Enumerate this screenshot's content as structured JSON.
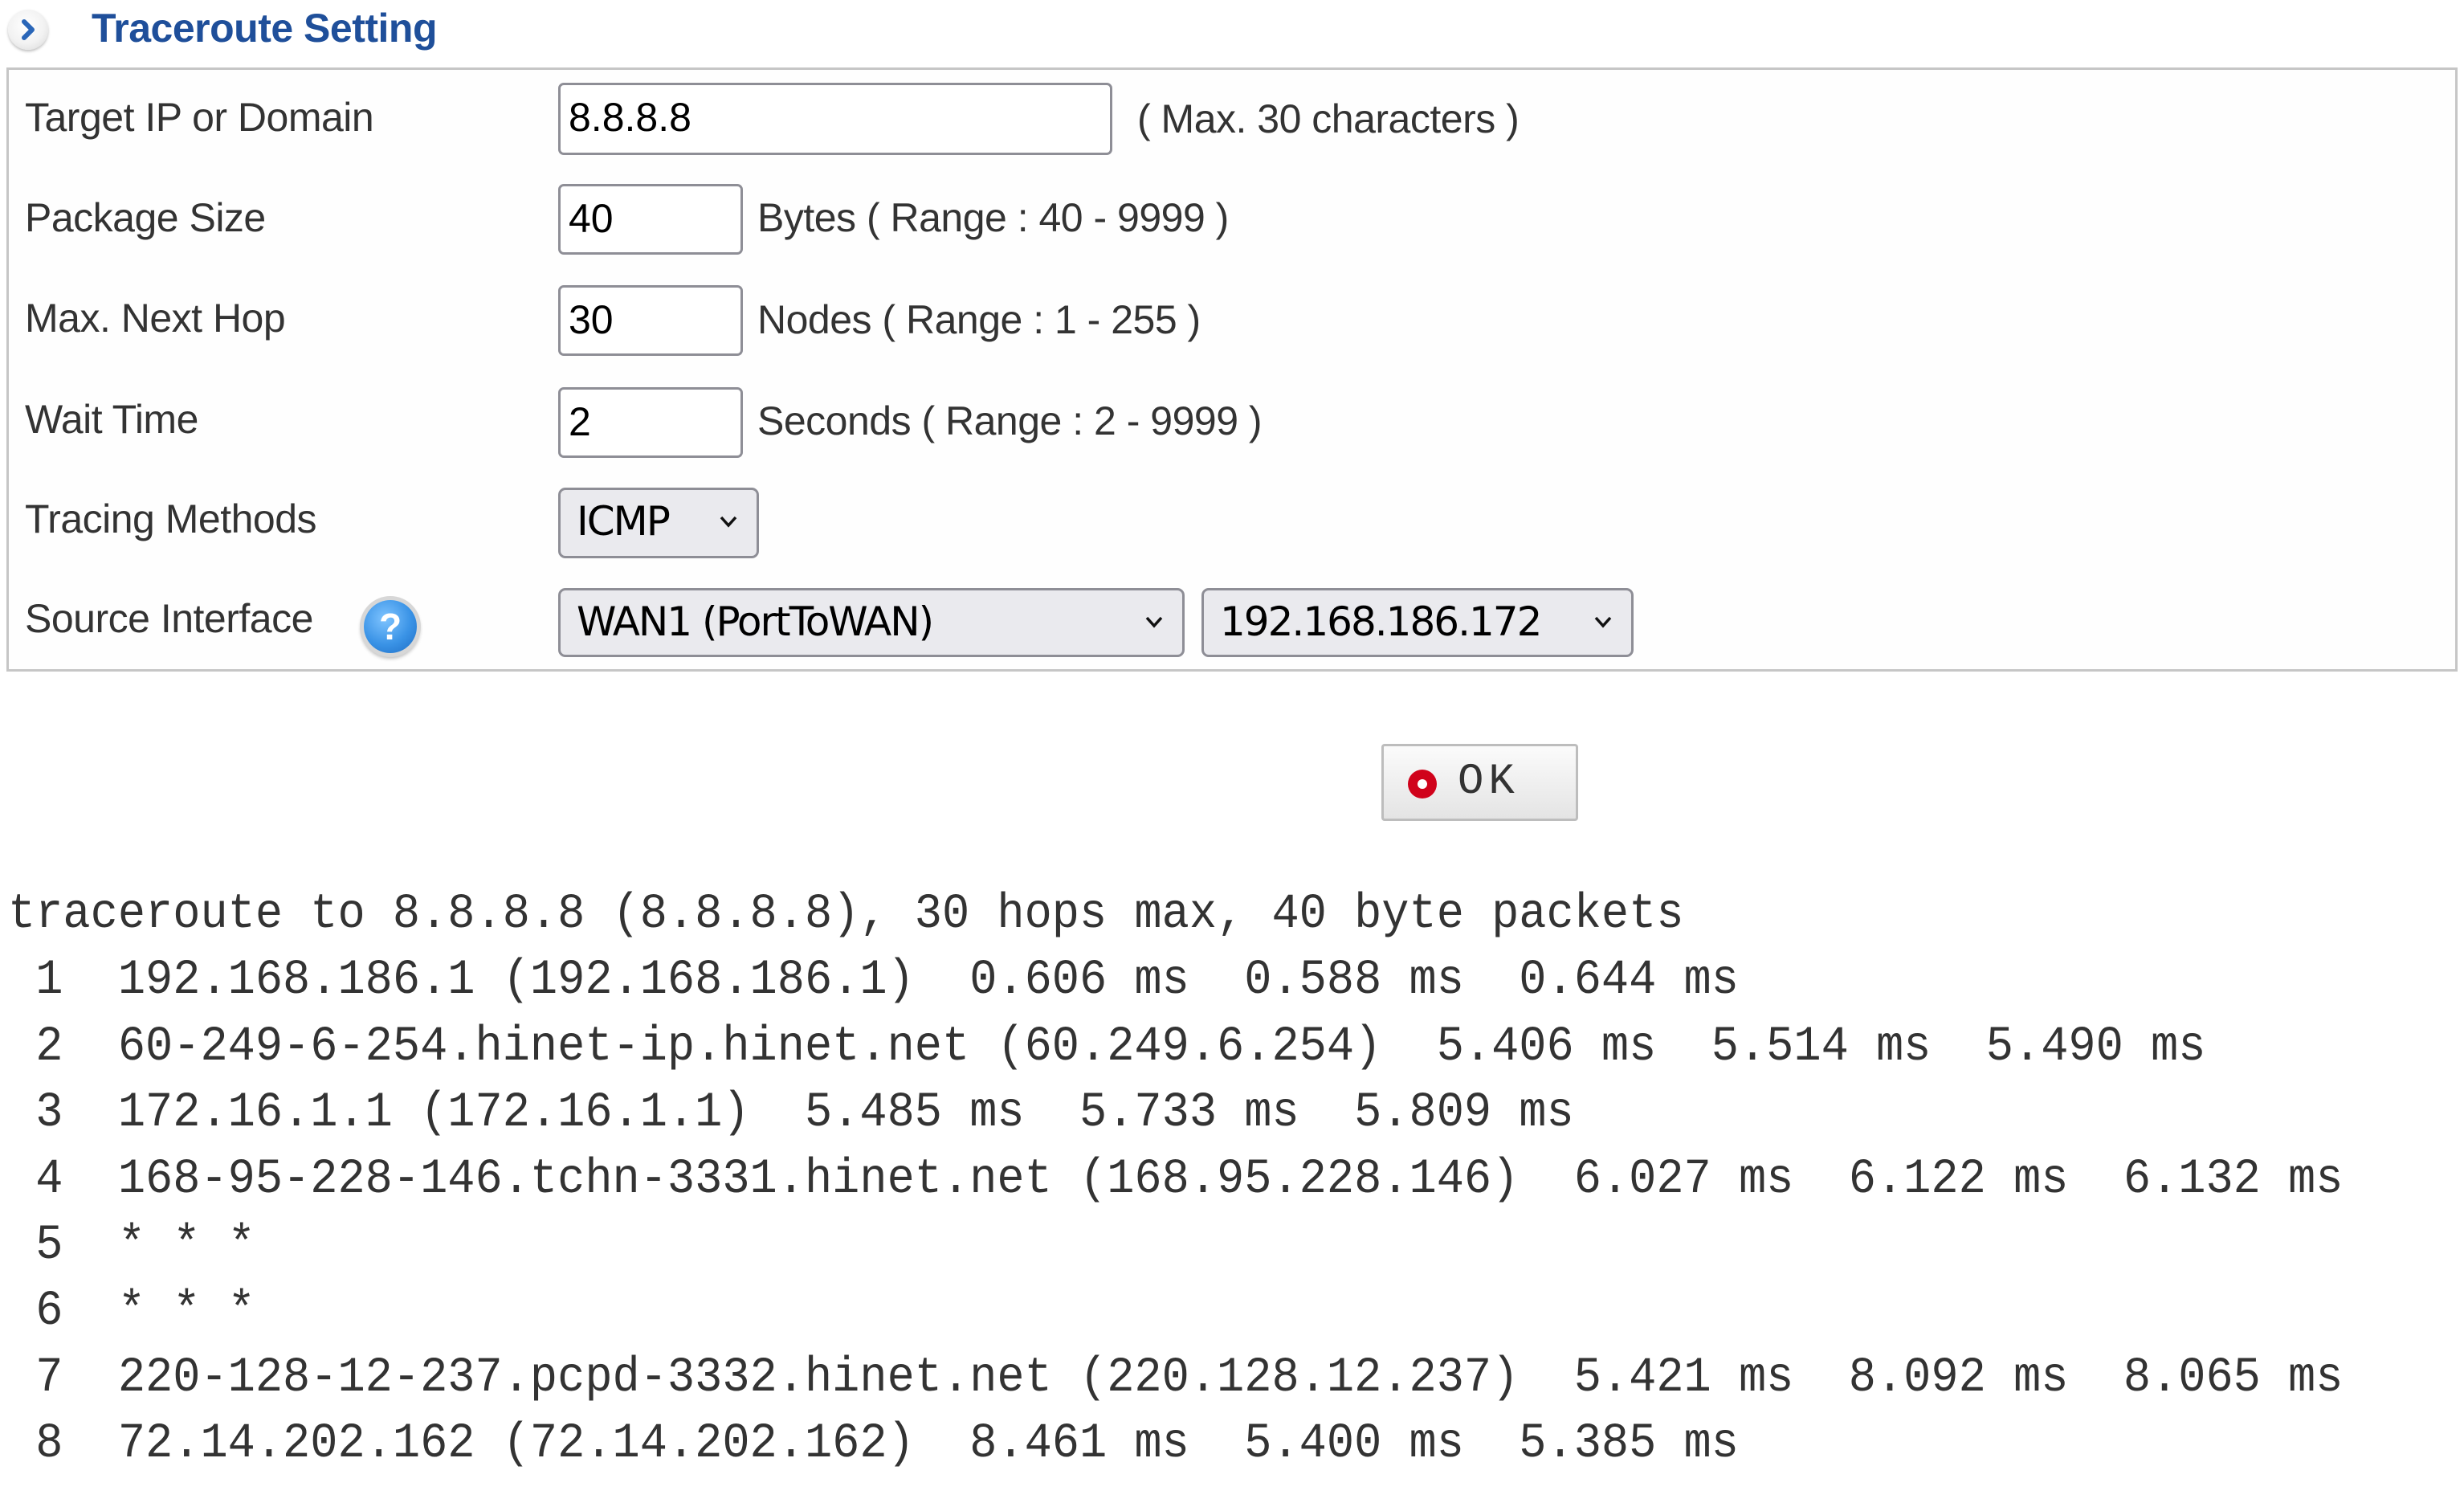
{
  "header": {
    "title": "Traceroute Setting",
    "icon": "chevron-right-circle-icon"
  },
  "form": {
    "target": {
      "label": "Target IP or Domain",
      "value": "8.8.8.8",
      "hint": "( Max. 30 characters )"
    },
    "package_size": {
      "label": "Package Size",
      "value": "40",
      "hint": "Bytes  ( Range : 40 - 9999 )"
    },
    "max_next_hop": {
      "label": "Max. Next Hop",
      "value": "30",
      "hint": "Nodes  ( Range : 1 - 255 )"
    },
    "wait_time": {
      "label": "Wait Time",
      "value": "2",
      "hint": "Seconds  ( Range : 2 - 9999 )"
    },
    "tracing_methods": {
      "label": "Tracing Methods",
      "selected": "ICMP"
    },
    "source_interface": {
      "label": "Source Interface",
      "help_icon": "question-help-icon",
      "interface_selected": "WAN1 (PortToWAN)",
      "ip_selected": "192.168.186.172"
    }
  },
  "ok_button": {
    "label": "OK",
    "icon": "red-dot-icon"
  },
  "output": {
    "lines": [
      "traceroute to 8.8.8.8 (8.8.8.8), 30 hops max, 40 byte packets",
      " 1  192.168.186.1 (192.168.186.1)  0.606 ms  0.588 ms  0.644 ms",
      " 2  60-249-6-254.hinet-ip.hinet.net (60.249.6.254)  5.406 ms  5.514 ms  5.490 ms",
      " 3  172.16.1.1 (172.16.1.1)  5.485 ms  5.733 ms  5.809 ms",
      " 4  168-95-228-146.tchn-3331.hinet.net (168.95.228.146)  6.027 ms  6.122 ms  6.132 ms",
      " 5  * * *",
      " 6  * * *",
      " 7  220-128-12-237.pcpd-3332.hinet.net (220.128.12.237)  5.421 ms  8.092 ms  8.065 ms",
      " 8  72.14.202.162 (72.14.202.162)  8.461 ms  5.400 ms  5.385 ms"
    ]
  },
  "colors": {
    "title": "#1f4f9a",
    "box_border": "#c6c6c6",
    "ok_dot": "#d0021b",
    "help_icon": "#3a93e6"
  }
}
